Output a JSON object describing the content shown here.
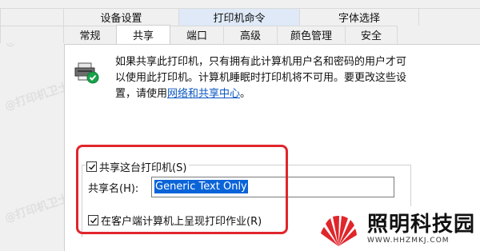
{
  "tabs": {
    "row1": [
      {
        "label": "设备设置"
      },
      {
        "label": "打印机命令"
      },
      {
        "label": "字体选择"
      }
    ],
    "row2": [
      {
        "label": "常规"
      },
      {
        "label": "共享"
      },
      {
        "label": "端口"
      },
      {
        "label": "高级"
      },
      {
        "label": "颜色管理"
      },
      {
        "label": "安全"
      }
    ]
  },
  "sharing": {
    "description": "如果共享此打印机，只有拥有此计算机用户名和密码的用户才可以使用此打印机。计算机睡眠时打印机将不可用。要更改这些设置，请使用",
    "link_text": "网络和共享中心",
    "link_suffix": "。",
    "share_checkbox_label": "共享这台打印机(S)",
    "share_checked": true,
    "share_name_label": "共享名(H):",
    "share_name_value": "Generic  Text Only",
    "render_jobs_label": "在客户端计算机上呈现打印作业(R)",
    "render_jobs_checked": true
  },
  "watermark": {
    "text": "@打印机卫士"
  },
  "brand": {
    "name": "照明科技园",
    "url": "WWW.HHZMKJ.COM"
  },
  "colors": {
    "highlight_border": "#e0262b",
    "link": "#0a56c2",
    "selection": "#0a64d8",
    "brand_accent": "#e0262b"
  }
}
